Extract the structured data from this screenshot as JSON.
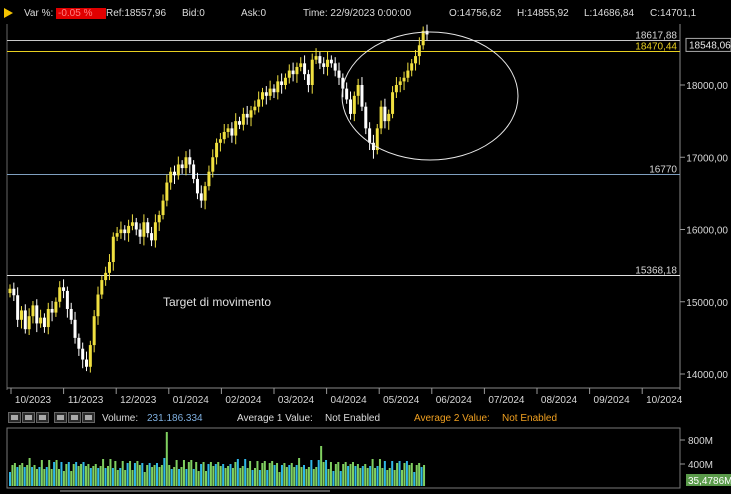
{
  "header": {
    "var_label": "Var %:",
    "var_value": "-0.05 %",
    "ref": "Ref:18557,96",
    "bid": "Bid:0",
    "ask": "Ask:0",
    "time": "Time:  22/9/2023 0:00:00",
    "open": "O:14756,62",
    "high": "H:14855,92",
    "low": "L:14686,84",
    "close": "C:14701,1"
  },
  "colors": {
    "up_candle": "#f0e040",
    "down_candle": "#ffffff",
    "yellow_line": "#e8d020",
    "blue_line": "#7f9fbf",
    "volume_green": "#80d060",
    "volume_blue": "#30b8e8",
    "axis_text": "#d8d8d8"
  },
  "chart_data": [
    {
      "type": "candlestick",
      "title": "",
      "y_ticks": [
        "14000,00",
        "15000,00",
        "16000,00",
        "17000,00",
        "18000,00"
      ],
      "ylim": [
        13900,
        18860
      ],
      "x_ticks": [
        "10/2023",
        "11/2023",
        "12/2023",
        "01/2024",
        "02/2024",
        "03/2024",
        "04/2024",
        "05/2024",
        "06/2024",
        "07/2024",
        "08/2024",
        "09/2024",
        "10/2024"
      ],
      "close_series": [
        15180,
        15090,
        14750,
        14880,
        14620,
        14800,
        14950,
        14700,
        14780,
        14650,
        14900,
        14850,
        15000,
        15200,
        15150,
        14900,
        14750,
        14500,
        14350,
        14200,
        14100,
        14400,
        14800,
        15100,
        15300,
        15400,
        15550,
        15900,
        15950,
        16000,
        15950,
        16050,
        16100,
        16000,
        15900,
        16100,
        15950,
        15850,
        16100,
        16200,
        16400,
        16650,
        16800,
        16750,
        16900,
        16850,
        17000,
        16900,
        16700,
        16500,
        16400,
        16600,
        16800,
        17000,
        17200,
        17250,
        17350,
        17400,
        17300,
        17500,
        17450,
        17600,
        17550,
        17650,
        17700,
        17800,
        17900,
        17850,
        17950,
        17900,
        18050,
        18000,
        18100,
        18200,
        18150,
        18250,
        18300,
        18150,
        18000,
        18350,
        18400,
        18300,
        18250,
        18350,
        18300,
        18200,
        18100,
        17950,
        17800,
        17600,
        17850,
        18000,
        17700,
        17400,
        17200,
        17100,
        17400,
        17700,
        17500,
        17600,
        17900,
        18000,
        18050,
        18100,
        18200,
        18300,
        18400,
        18550,
        18750,
        18700
      ],
      "horizontal_lines": [
        {
          "label": "18617,88",
          "value": 18617.88,
          "color": "#c8c8c8"
        },
        {
          "label": "18470,44",
          "value": 18470.44,
          "color": "#e8d020"
        },
        {
          "label": "16770",
          "value": 16770,
          "color": "#7f9fbf"
        },
        {
          "label": "15368,18",
          "value": 15368.18,
          "color": "#e0e0e0"
        }
      ],
      "last_price_label": "18548,06",
      "annotation": "Target di movimento"
    },
    {
      "type": "bar",
      "title": "Volume",
      "y_ticks": [
        "800M",
        "400M"
      ],
      "last_value_label": "35,4786M",
      "ylim": [
        0,
        1000
      ]
    }
  ],
  "volume_bar": {
    "label": "Volume:",
    "value": "231.186.334",
    "avg1_label": "Average 1 Value:",
    "avg1_value": "Not Enabled",
    "avg2_label": "Average 2 Value:",
    "avg2_value": "Not Enabled"
  }
}
